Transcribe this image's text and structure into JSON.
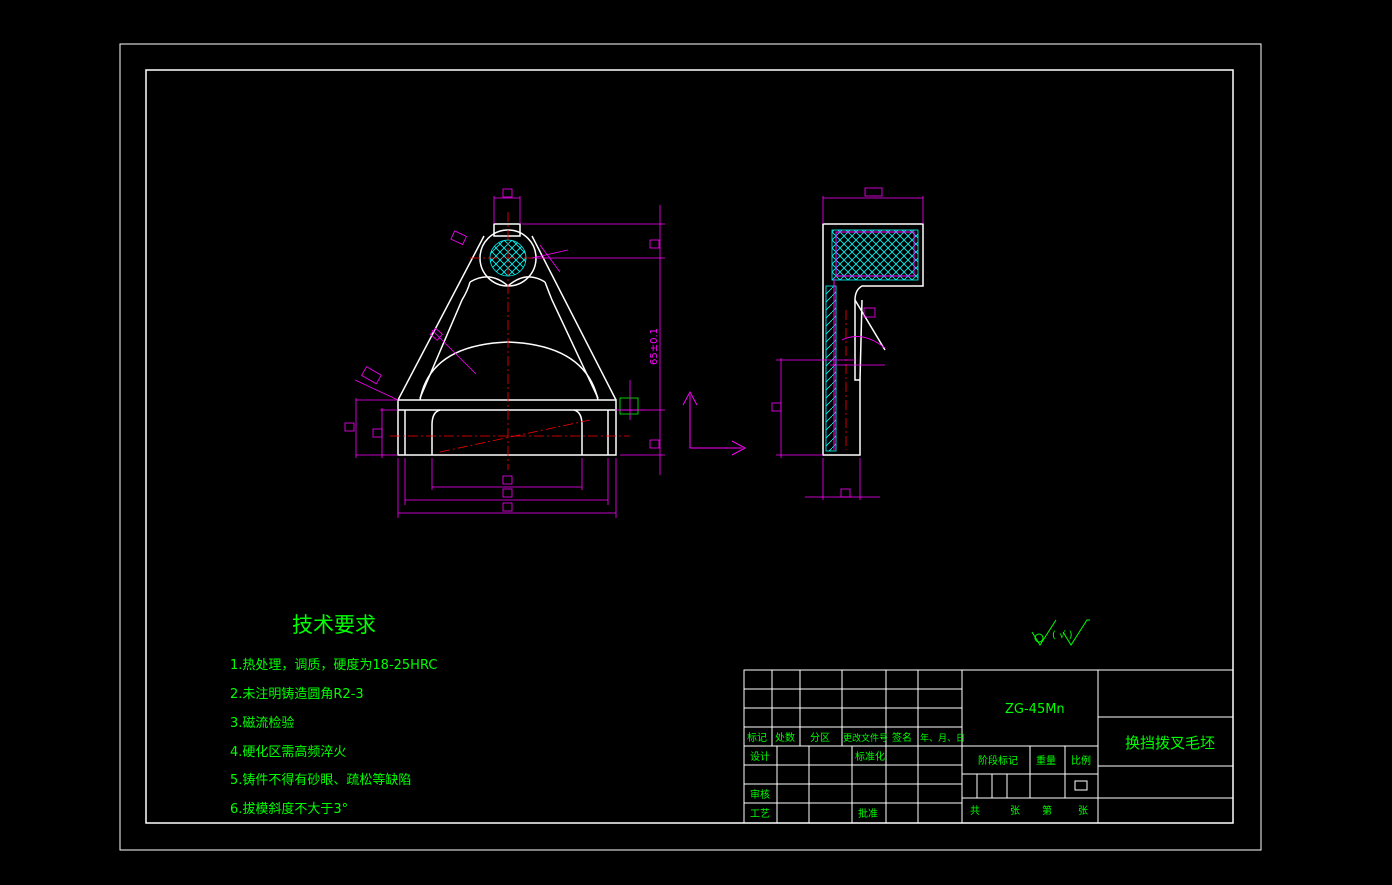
{
  "tech_requirements": {
    "title": "技术要求",
    "items": [
      "1.热处理，调质，硬度为18-25HRC",
      "2.未注明铸造圆角R2-3",
      "3.磁流检验",
      "4.硬化区需高频淬火",
      "5.铸件不得有砂眼、疏松等缺陷",
      "6.拔模斜度不大于3°"
    ]
  },
  "dimension_labels": {
    "center_distance": "65±0.1"
  },
  "surface_finish": {
    "note": "( √ )"
  },
  "title_block": {
    "material": "ZG-45Mn",
    "part_name": "换挡拨叉毛坯",
    "rev_headers": [
      "标记",
      "处数",
      "分区",
      "更改文件号",
      "签名",
      "年、月、日"
    ],
    "design": "设计",
    "standardization": "标准化",
    "review": "审核",
    "process": "工艺",
    "approve": "批准",
    "stage_mark": "阶段标记",
    "weight": "重量",
    "scale": "比例",
    "total": "共",
    "sheet": "张",
    "page": "第",
    "sheet2": "张"
  },
  "colors": {
    "outline": "#ffffff",
    "dimension": "#ff00ff",
    "text": "#00ff00",
    "center": "#ff0000",
    "hatch": "#00ffff"
  }
}
